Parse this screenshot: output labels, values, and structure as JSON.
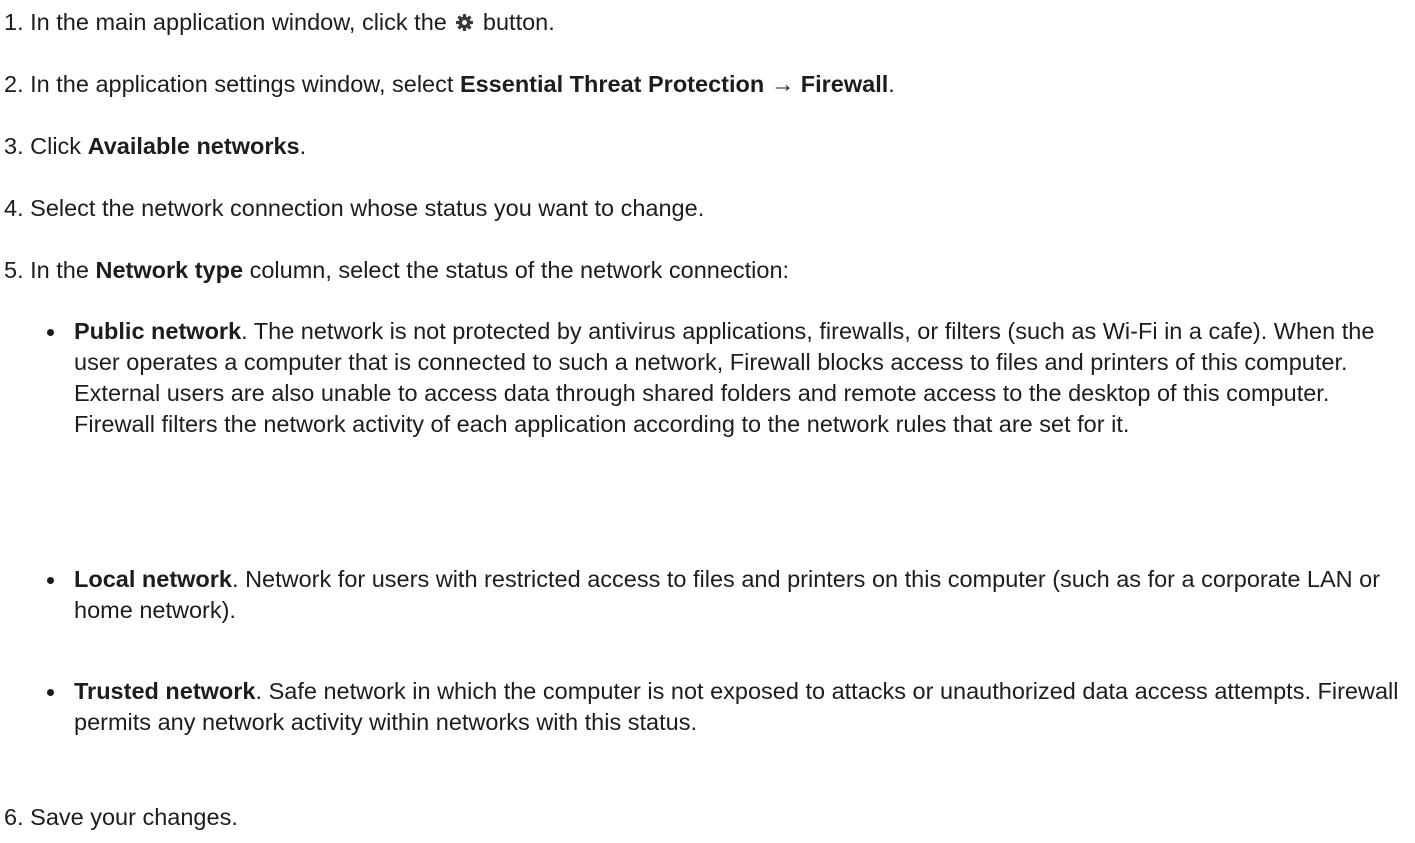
{
  "steps": [
    {
      "number": "1.",
      "text_before": "In the main application window, click the",
      "icon": "gear-icon",
      "text_after": "button."
    },
    {
      "number": "2.",
      "text_before": "In the application settings window, select",
      "bold": "Essential Threat Protection → Firewall",
      "text_after": "."
    },
    {
      "number": "3.",
      "text_before": "Click",
      "bold": "Available networks",
      "text_after": "."
    },
    {
      "number": "4.",
      "text": "Select the network connection whose status you want to change."
    },
    {
      "number": "5.",
      "text_before": "In the",
      "bold": "Network type",
      "text_after": "column, select the status of the network connection:"
    },
    {
      "number": "6.",
      "text": "Save your changes."
    }
  ],
  "network_types": [
    {
      "name": "Public network",
      "description": ". The network is not protected by antivirus applications, firewalls, or filters (such as Wi-Fi in a cafe). When the user operates a computer that is connected to such a network, Firewall blocks access to files and printers of this computer. External users are also unable to access data through shared folders and remote access to the desktop of this computer. Firewall filters the network activity of each application according to the network rules that are set for it."
    },
    {
      "name": "Local network",
      "description": ". Network for users with restricted access to files and printers on this computer (such as for a corporate LAN or home network)."
    },
    {
      "name": "Trusted network",
      "description": ". Safe network in which the computer is not exposed to attacks or unauthorized data access attempts. Firewall permits any network activity within networks with this status."
    }
  ]
}
